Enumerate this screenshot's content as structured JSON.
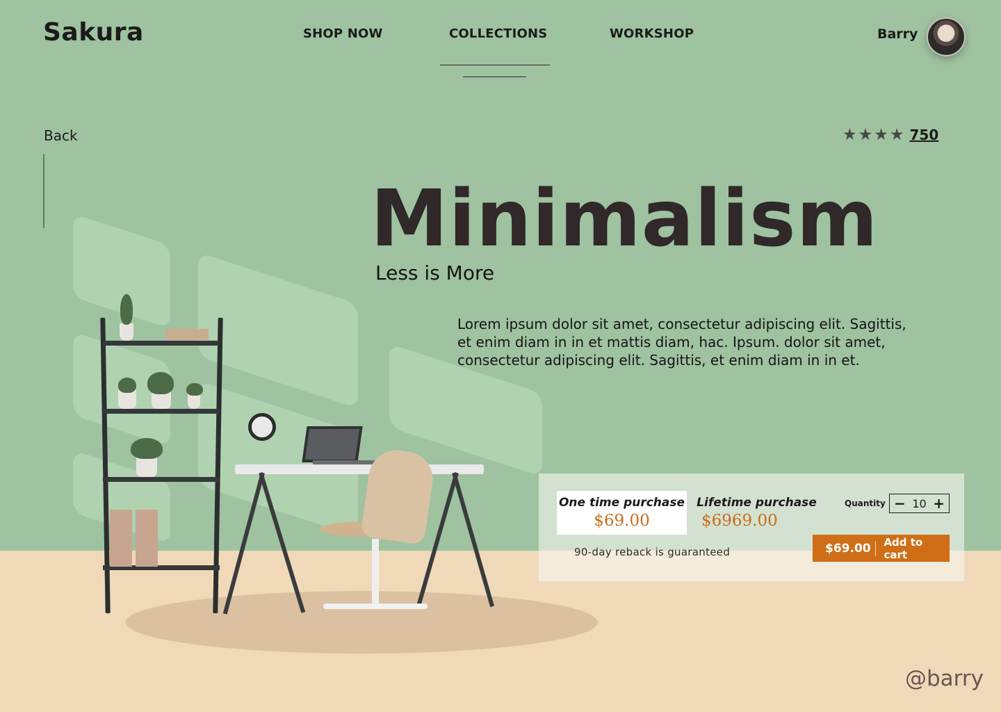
{
  "header": {
    "brand": "Sakura",
    "nav": [
      {
        "label": "SHOP NOW"
      },
      {
        "label": "COLLECTIONS"
      },
      {
        "label": "WORKSHOP"
      }
    ],
    "active_nav": "COLLECTIONS",
    "user": {
      "name": "Barry",
      "avatar_icon": "user-avatar"
    }
  },
  "page": {
    "back_label": "Back",
    "rating": {
      "stars": 4,
      "count": "750",
      "star_icon": "star-icon"
    },
    "title": "Minimalism",
    "subtitle": "Less is More",
    "description": "Lorem ipsum dolor sit amet, consectetur adipiscing elit. Sagittis, et enim diam in in et mattis diam, hac. Ipsum. dolor sit amet, consectetur adipiscing elit. Sagittis, et enim diam in in et."
  },
  "purchase": {
    "options": [
      {
        "label": "One time purchase",
        "price": "$69.00",
        "selected": true
      },
      {
        "label": "Lifetime purchase",
        "price": "$6969.00",
        "selected": false
      }
    ],
    "quantity_label": "Quantity",
    "quantity": "10",
    "minus_symbol": "−",
    "plus_symbol": "+",
    "guarantee": "90-day reback is guaranteed",
    "cart_price": "$69.00",
    "cart_label": "Add to cart"
  },
  "footer": {
    "handle": "@barry"
  },
  "colors": {
    "wall": "#9fc2a0",
    "floor": "#f0d9b9",
    "accent": "#cf6e16",
    "price": "#c96d1a",
    "title": "#302829"
  }
}
